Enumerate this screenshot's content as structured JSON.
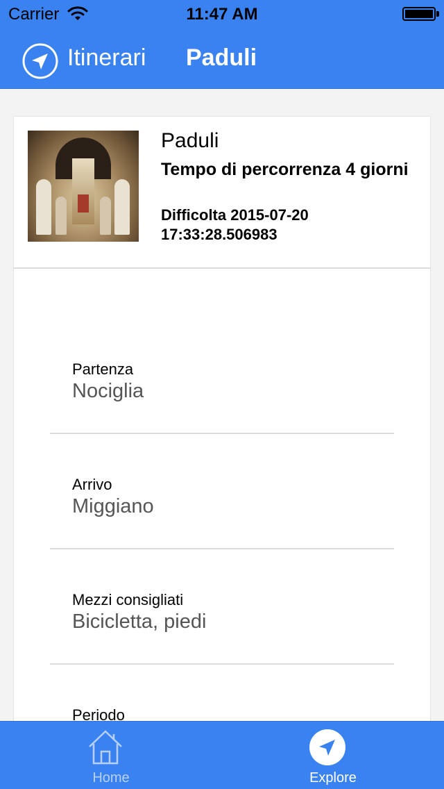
{
  "status_bar": {
    "carrier": "Carrier",
    "time": "11:47 AM",
    "icons": [
      "wifi-icon",
      "battery-icon"
    ]
  },
  "nav_bar": {
    "back_label": "Itinerari",
    "back_icon": "navigation-arrow-icon",
    "title": "Paduli"
  },
  "card": {
    "title": "Paduli",
    "duration": "Tempo di percorrenza 4 giorni",
    "difficulty": "Difficolta 2015-07-20 17:33:28.506983",
    "image": "church-interior-thumbnail"
  },
  "fields": [
    {
      "label": "Partenza",
      "value": "Nociglia"
    },
    {
      "label": "Arrivo",
      "value": "Miggiano"
    },
    {
      "label": "Mezzi consigliati",
      "value": "Bicicletta, piedi"
    },
    {
      "label": "Periodo",
      "value": ""
    }
  ],
  "tab_bar": {
    "items": [
      {
        "label": "Home",
        "icon": "house-icon",
        "selected": false
      },
      {
        "label": "Explore",
        "icon": "navigation-arrow-icon",
        "selected": true
      }
    ]
  },
  "colors": {
    "accent": "#3a82f0",
    "value_text": "#555555",
    "divider": "#dcdcdc",
    "background": "#f3f3f3"
  }
}
